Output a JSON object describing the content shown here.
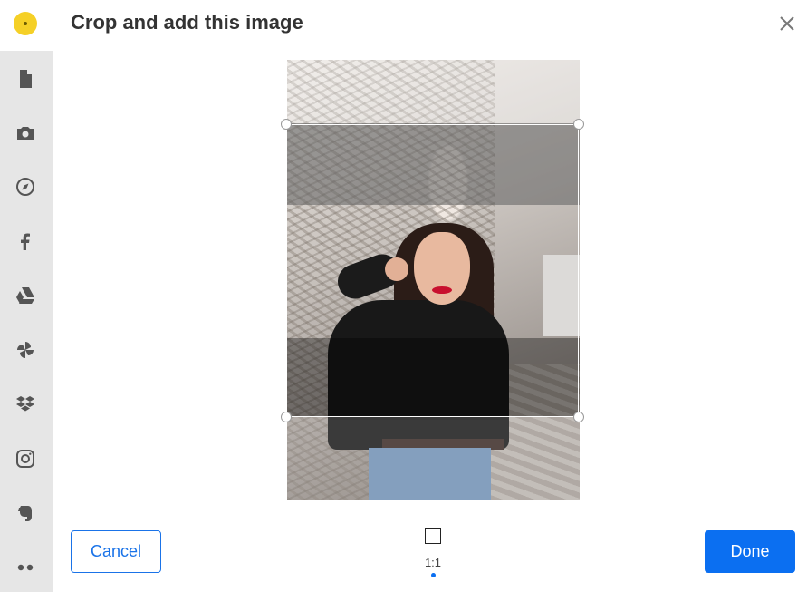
{
  "dialog": {
    "title": "Crop and add this image",
    "close_icon": "close-icon"
  },
  "sidebar": {
    "items": [
      {
        "name": "file",
        "icon": "file-icon"
      },
      {
        "name": "camera",
        "icon": "camera-icon"
      },
      {
        "name": "link",
        "icon": "compass-icon"
      },
      {
        "name": "facebook",
        "icon": "facebook-icon"
      },
      {
        "name": "google-drive",
        "icon": "google-drive-icon"
      },
      {
        "name": "google-photos",
        "icon": "pinwheel-icon"
      },
      {
        "name": "dropbox",
        "icon": "dropbox-icon"
      },
      {
        "name": "instagram",
        "icon": "instagram-icon"
      },
      {
        "name": "evernote",
        "icon": "evernote-icon"
      },
      {
        "name": "more",
        "icon": "more-icon"
      }
    ]
  },
  "crop": {
    "aspect_ratio_label": "1:1"
  },
  "buttons": {
    "cancel": "Cancel",
    "done": "Done"
  },
  "colors": {
    "primary": "#0b6ff1",
    "sidebar_bg": "#e6e6e6"
  }
}
